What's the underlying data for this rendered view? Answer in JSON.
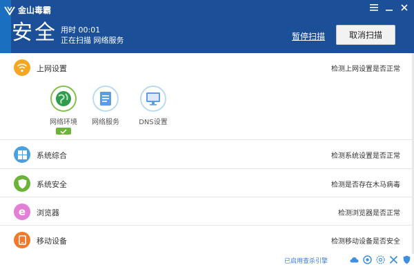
{
  "app": {
    "title": "金山毒霸"
  },
  "window_controls": [
    {
      "name": "menu-icon",
      "label": "≡"
    },
    {
      "name": "minimize-icon",
      "label": "–"
    },
    {
      "name": "close-icon",
      "label": "×"
    }
  ],
  "header": {
    "status": "安全",
    "elapsed": "用时 00:01",
    "scanning": "正在扫描  网络服务",
    "pause_label": "暂停扫描",
    "cancel_label": "取消扫描"
  },
  "colors": {
    "header_bg": "#1b4f97",
    "network_icon": "#f5a623",
    "system_icon": "#4ca0e0",
    "security_icon": "#6cb33a",
    "browser_icon": "#e47fd6",
    "mobile_icon": "#f07a2a",
    "check_green": "#6cb33a",
    "footer_link": "#3d7fd0"
  },
  "rows": [
    {
      "label": "上网设置",
      "status": "检测上网设置是否正常",
      "icon": "wifi-icon",
      "sub_items": [
        {
          "label": "网络环境",
          "icon": "globe-icon",
          "done": true
        },
        {
          "label": "网络服务",
          "icon": "document-icon",
          "done": false
        },
        {
          "label": "DNS设置",
          "icon": "monitor-icon",
          "done": false
        }
      ]
    },
    {
      "label": "系统综合",
      "status": "检测系统设置是否正常",
      "icon": "windows-icon"
    },
    {
      "label": "系统安全",
      "status": "检测是否存在木马病毒",
      "icon": "shield-icon"
    },
    {
      "label": "浏览器",
      "status": "检测浏览器是否正常",
      "icon": "browser-icon"
    },
    {
      "label": "移动设备",
      "status": "检测移动设备是否安全",
      "icon": "tablet-icon"
    }
  ],
  "footer": {
    "engine_text": "已启用查杀引擎",
    "icons": [
      "cloud-icon",
      "scan-engine-icon",
      "ai-engine-icon",
      "repair-icon",
      "defense-icon"
    ]
  }
}
